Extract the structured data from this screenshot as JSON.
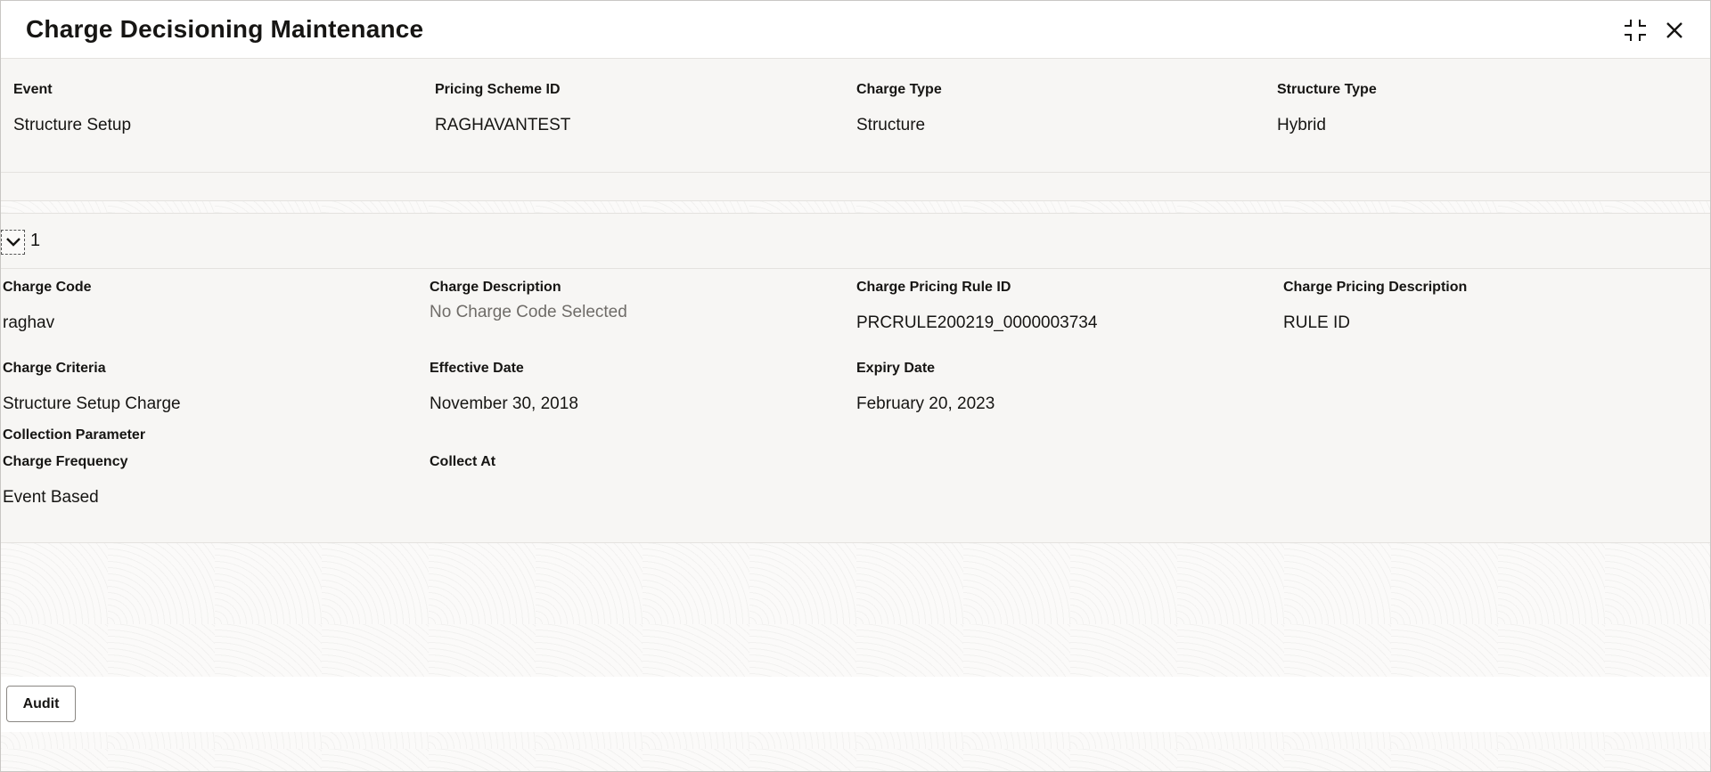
{
  "window": {
    "title": "Charge Decisioning Maintenance",
    "minimize_icon": "collapse-arrows-icon",
    "close_icon": "close-icon"
  },
  "summary": {
    "event": {
      "label": "Event",
      "value": "Structure Setup"
    },
    "pricing_scheme_id": {
      "label": "Pricing Scheme ID",
      "value": "RAGHAVANTEST"
    },
    "charge_type": {
      "label": "Charge Type",
      "value": "Structure"
    },
    "structure_type": {
      "label": "Structure Type",
      "value": "Hybrid"
    }
  },
  "accordion": {
    "number": "1",
    "toggle_icon": "chevron-down-icon",
    "charge_code": {
      "label": "Charge Code",
      "value": "raghav"
    },
    "charge_description": {
      "label": "Charge Description",
      "value": "No Charge Code Selected"
    },
    "charge_pricing_rule_id": {
      "label": "Charge Pricing Rule ID",
      "value": "PRCRULE200219_0000003734"
    },
    "charge_pricing_description": {
      "label": "Charge Pricing Description",
      "value": "RULE ID"
    },
    "charge_criteria": {
      "label": "Charge Criteria",
      "value": "Structure Setup Charge"
    },
    "effective_date": {
      "label": "Effective Date",
      "value": "November 30, 2018"
    },
    "expiry_date": {
      "label": "Expiry Date",
      "value": "February 20, 2023"
    },
    "collection_parameter_title": "Collection Parameter",
    "charge_frequency": {
      "label": "Charge Frequency",
      "value": "Event Based"
    },
    "collect_at": {
      "label": "Collect At",
      "value": ""
    }
  },
  "footer": {
    "audit_label": "Audit"
  }
}
